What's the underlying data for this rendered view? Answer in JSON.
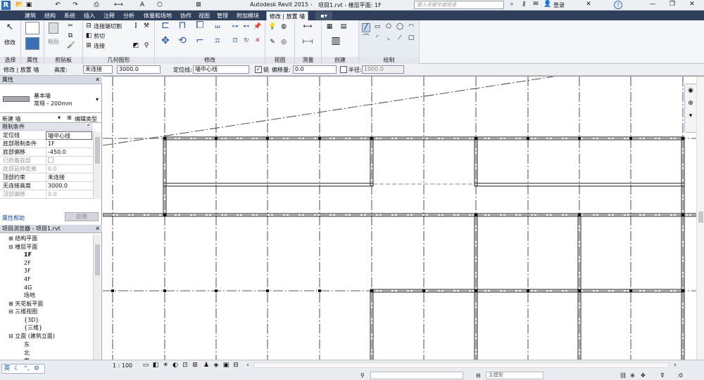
{
  "title": {
    "app": "Autodesk Revit 2015 -",
    "doc": "项目1.rvt - 楼层平面: 1F",
    "search_placeholder": "键入关键字或短语",
    "login": "登录"
  },
  "tabs": [
    "建筑",
    "结构",
    "系统",
    "插入",
    "注释",
    "分析",
    "体量和场地",
    "协作",
    "视图",
    "管理",
    "附加模块",
    "修改 | 放置 墙"
  ],
  "ribbon": {
    "panels": [
      "选择",
      "属性",
      "剪贴板",
      "几何图形",
      "修改",
      "视图",
      "测量",
      "创建",
      "绘制"
    ],
    "modify_label": "修改",
    "paste_label": "粘贴",
    "join_label": "连接端切割",
    "cut_label": "剪切",
    "connect_label": "连接"
  },
  "options": {
    "context": "修改 | 放置 墙",
    "height_label": "高度:",
    "height_value": "未连接",
    "height_num": "3000.0",
    "loc_label": "定位线:",
    "loc_value": "墙中心线",
    "chain_label": "链",
    "offset_label": "偏移量:",
    "offset_value": "0.0",
    "radius_label": "半径:",
    "radius_value": "1000.0"
  },
  "properties": {
    "header": "属性",
    "type_name": "基本墙",
    "type_sub": "常规 - 200mm",
    "new_label": "新建 墙",
    "edit_type": "编辑类型",
    "section": "限制条件",
    "rows": [
      [
        "定位线",
        "墙中心线"
      ],
      [
        "底部限制条件",
        "1F"
      ],
      [
        "底部偏移",
        "-450.0"
      ],
      [
        "已附着底部",
        ""
      ],
      [
        "底部延伸距离",
        "0.0"
      ],
      [
        "顶部约束",
        "未连接"
      ],
      [
        "无连接高度",
        "3000.0"
      ],
      [
        "顶部偏移",
        "0.0"
      ]
    ],
    "help": "属性帮助",
    "apply": "应用"
  },
  "browser": {
    "header": "项目浏览器 - 项目1.rvt",
    "items": [
      "结构平面",
      "楼层平面",
      "1F",
      "2F",
      "3F",
      "4F",
      "4G",
      "场地",
      "天花板平面",
      "三维视图",
      "{3D}",
      "{三维}",
      "立面 (建筑立面)",
      "东",
      "北",
      "南"
    ]
  },
  "status": {
    "scale": "1 : 100",
    "model": "主模型",
    "ime": "英",
    "zero": ":0"
  }
}
